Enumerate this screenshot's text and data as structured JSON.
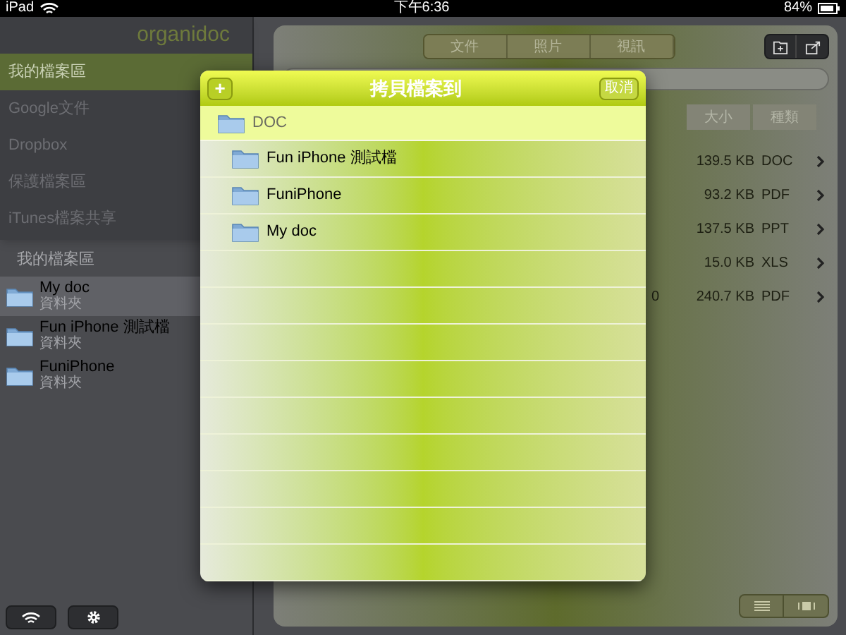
{
  "status_bar": {
    "device": "iPad",
    "time": "下午6:36",
    "battery": "84%"
  },
  "sidebar": {
    "logo": "organidoc",
    "items": [
      {
        "label": "我的檔案區",
        "selected": true
      },
      {
        "label": "Google文件",
        "selected": false
      },
      {
        "label": "Dropbox",
        "selected": false
      },
      {
        "label": "保護檔案區",
        "selected": false
      },
      {
        "label": "iTunes檔案共享",
        "selected": false
      }
    ],
    "section_title": "我的檔案區",
    "folders": [
      {
        "name": "My doc",
        "subtitle": "資料夾",
        "selected": true
      },
      {
        "name": "Fun iPhone 測試檔",
        "subtitle": "資料夾",
        "selected": false
      },
      {
        "name": "FuniPhone",
        "subtitle": "資料夾",
        "selected": false
      }
    ]
  },
  "main": {
    "tabs": [
      {
        "label": "文件",
        "selected": false
      },
      {
        "label": "照片",
        "selected": false
      },
      {
        "label": "視訊",
        "selected": false
      }
    ],
    "columns": [
      "大小",
      "種類"
    ],
    "rows": [
      {
        "size": "139.5 KB",
        "type": "DOC"
      },
      {
        "size": "93.2 KB",
        "type": "PDF"
      },
      {
        "size": "137.5 KB",
        "type": "PPT"
      },
      {
        "size": "15.0 KB",
        "type": "XLS"
      },
      {
        "column_1": "0",
        "size": "240.7 KB",
        "type": "PDF"
      }
    ]
  },
  "dialog": {
    "title": "拷貝檔案到",
    "add_button": "+",
    "cancel_button": "取消",
    "root": {
      "name": "DOC",
      "selected": true,
      "children": [
        {
          "name": "Fun iPhone 測試檔",
          "selected": false
        },
        {
          "name": "FuniPhone",
          "selected": false
        },
        {
          "name": "My doc",
          "selected": false
        }
      ]
    }
  }
}
